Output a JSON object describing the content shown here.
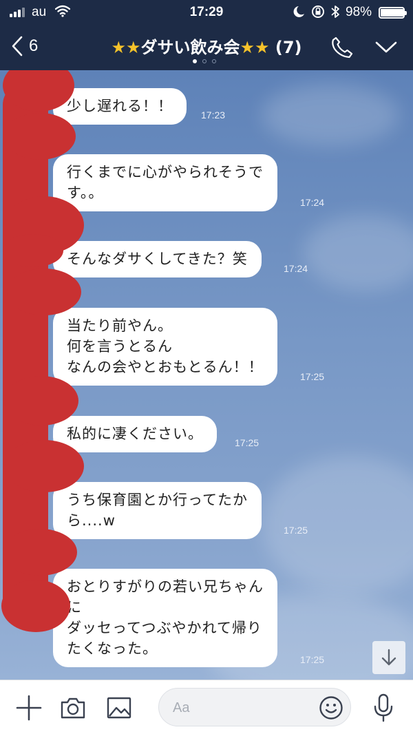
{
  "status_bar": {
    "carrier": "au",
    "time": "17:29",
    "battery": "98%",
    "battery_level": 0.98,
    "icons": [
      "signal-icon",
      "wifi-icon",
      "moon-icon",
      "rotation-lock-icon",
      "bluetooth-icon",
      "battery-icon"
    ]
  },
  "header": {
    "back_count": "6",
    "title_star_left": "★★",
    "title_text": "ダサい飲み会",
    "title_star_right": "★★",
    "member_count": "(7)",
    "accent": "#f5c22b",
    "background": "#1d2b46",
    "icons": [
      "back-chevron-icon",
      "phone-icon",
      "chevron-down-icon"
    ]
  },
  "messages": [
    {
      "text": "少し遅れる！！",
      "time": "17:23"
    },
    {
      "text": "行くまでに心がやられそうで\nす。。",
      "time": "17:24"
    },
    {
      "text": "そんなダサくしてきた？笑",
      "time": "17:24"
    },
    {
      "text": "当たり前やん。\n何を言うとるん\nなんの会やとおもとるん！！",
      "time": "17:25"
    },
    {
      "text": "私的に凄ください。",
      "time": "17:25"
    },
    {
      "text": "うち保育園とか行ってたか\nら....w",
      "time": "17:25"
    },
    {
      "text": "おとりすがりの若い兄ちゃん\nに\nダッセってつぶやかれて帰り\nたくなった。",
      "time": "17:25"
    }
  ],
  "redaction_color": "#c93132",
  "composer": {
    "placeholder": "Aa",
    "icons": [
      "plus-icon",
      "camera-icon",
      "image-icon",
      "emoji-icon",
      "microphone-icon"
    ]
  },
  "scroll_button_icon": "arrow-down-icon"
}
